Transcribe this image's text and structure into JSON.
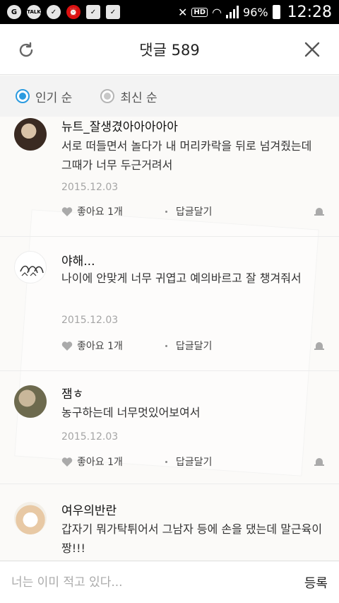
{
  "status_bar": {
    "notification_icons": [
      "g-icon",
      "talk-icon",
      "shield-icon",
      "alarm-icon",
      "download-icon",
      "clipboard-icon"
    ],
    "talk_label": "TALK",
    "hd_label": "HD",
    "battery": "96%",
    "time": "12:28"
  },
  "header": {
    "title": "댓글 589"
  },
  "sort": {
    "options": [
      {
        "label": "인기 순",
        "selected": true
      },
      {
        "label": "최신 순",
        "selected": false
      }
    ]
  },
  "comments": [
    {
      "author": "뉴트_잘생겼아아아아아",
      "text": "서로 떠들면서 놀다가 내 머리카락을 뒤로 넘겨줬는데 그때가 너무 두근거려서",
      "date": "2015.12.03",
      "like_label": "좋아요 1개",
      "reply_label": "답글달기"
    },
    {
      "author": "야해...",
      "text": "나이에 안맞게 너무 귀엽고 예의바르고 잘 챙겨줘서",
      "date": "2015.12.03",
      "like_label": "좋아요 1개",
      "reply_label": "답글달기"
    },
    {
      "author": "잼ㅎ",
      "text": "농구하는데 너무멋있어보여서",
      "date": "2015.12.03",
      "like_label": "좋아요 1개",
      "reply_label": "답글달기"
    },
    {
      "author": "여우의반란",
      "text": "갑자기 뭐가탁튀어서 그남자 등에 손을 댔는데 말근육이 짱!!!",
      "date": "",
      "like_label": "",
      "reply_label": ""
    }
  ],
  "input": {
    "placeholder": "너는 이미 적고 있다...",
    "submit_label": "등록"
  },
  "colors": {
    "accent": "#2b9be0",
    "status_bar_bg": "#000000"
  }
}
